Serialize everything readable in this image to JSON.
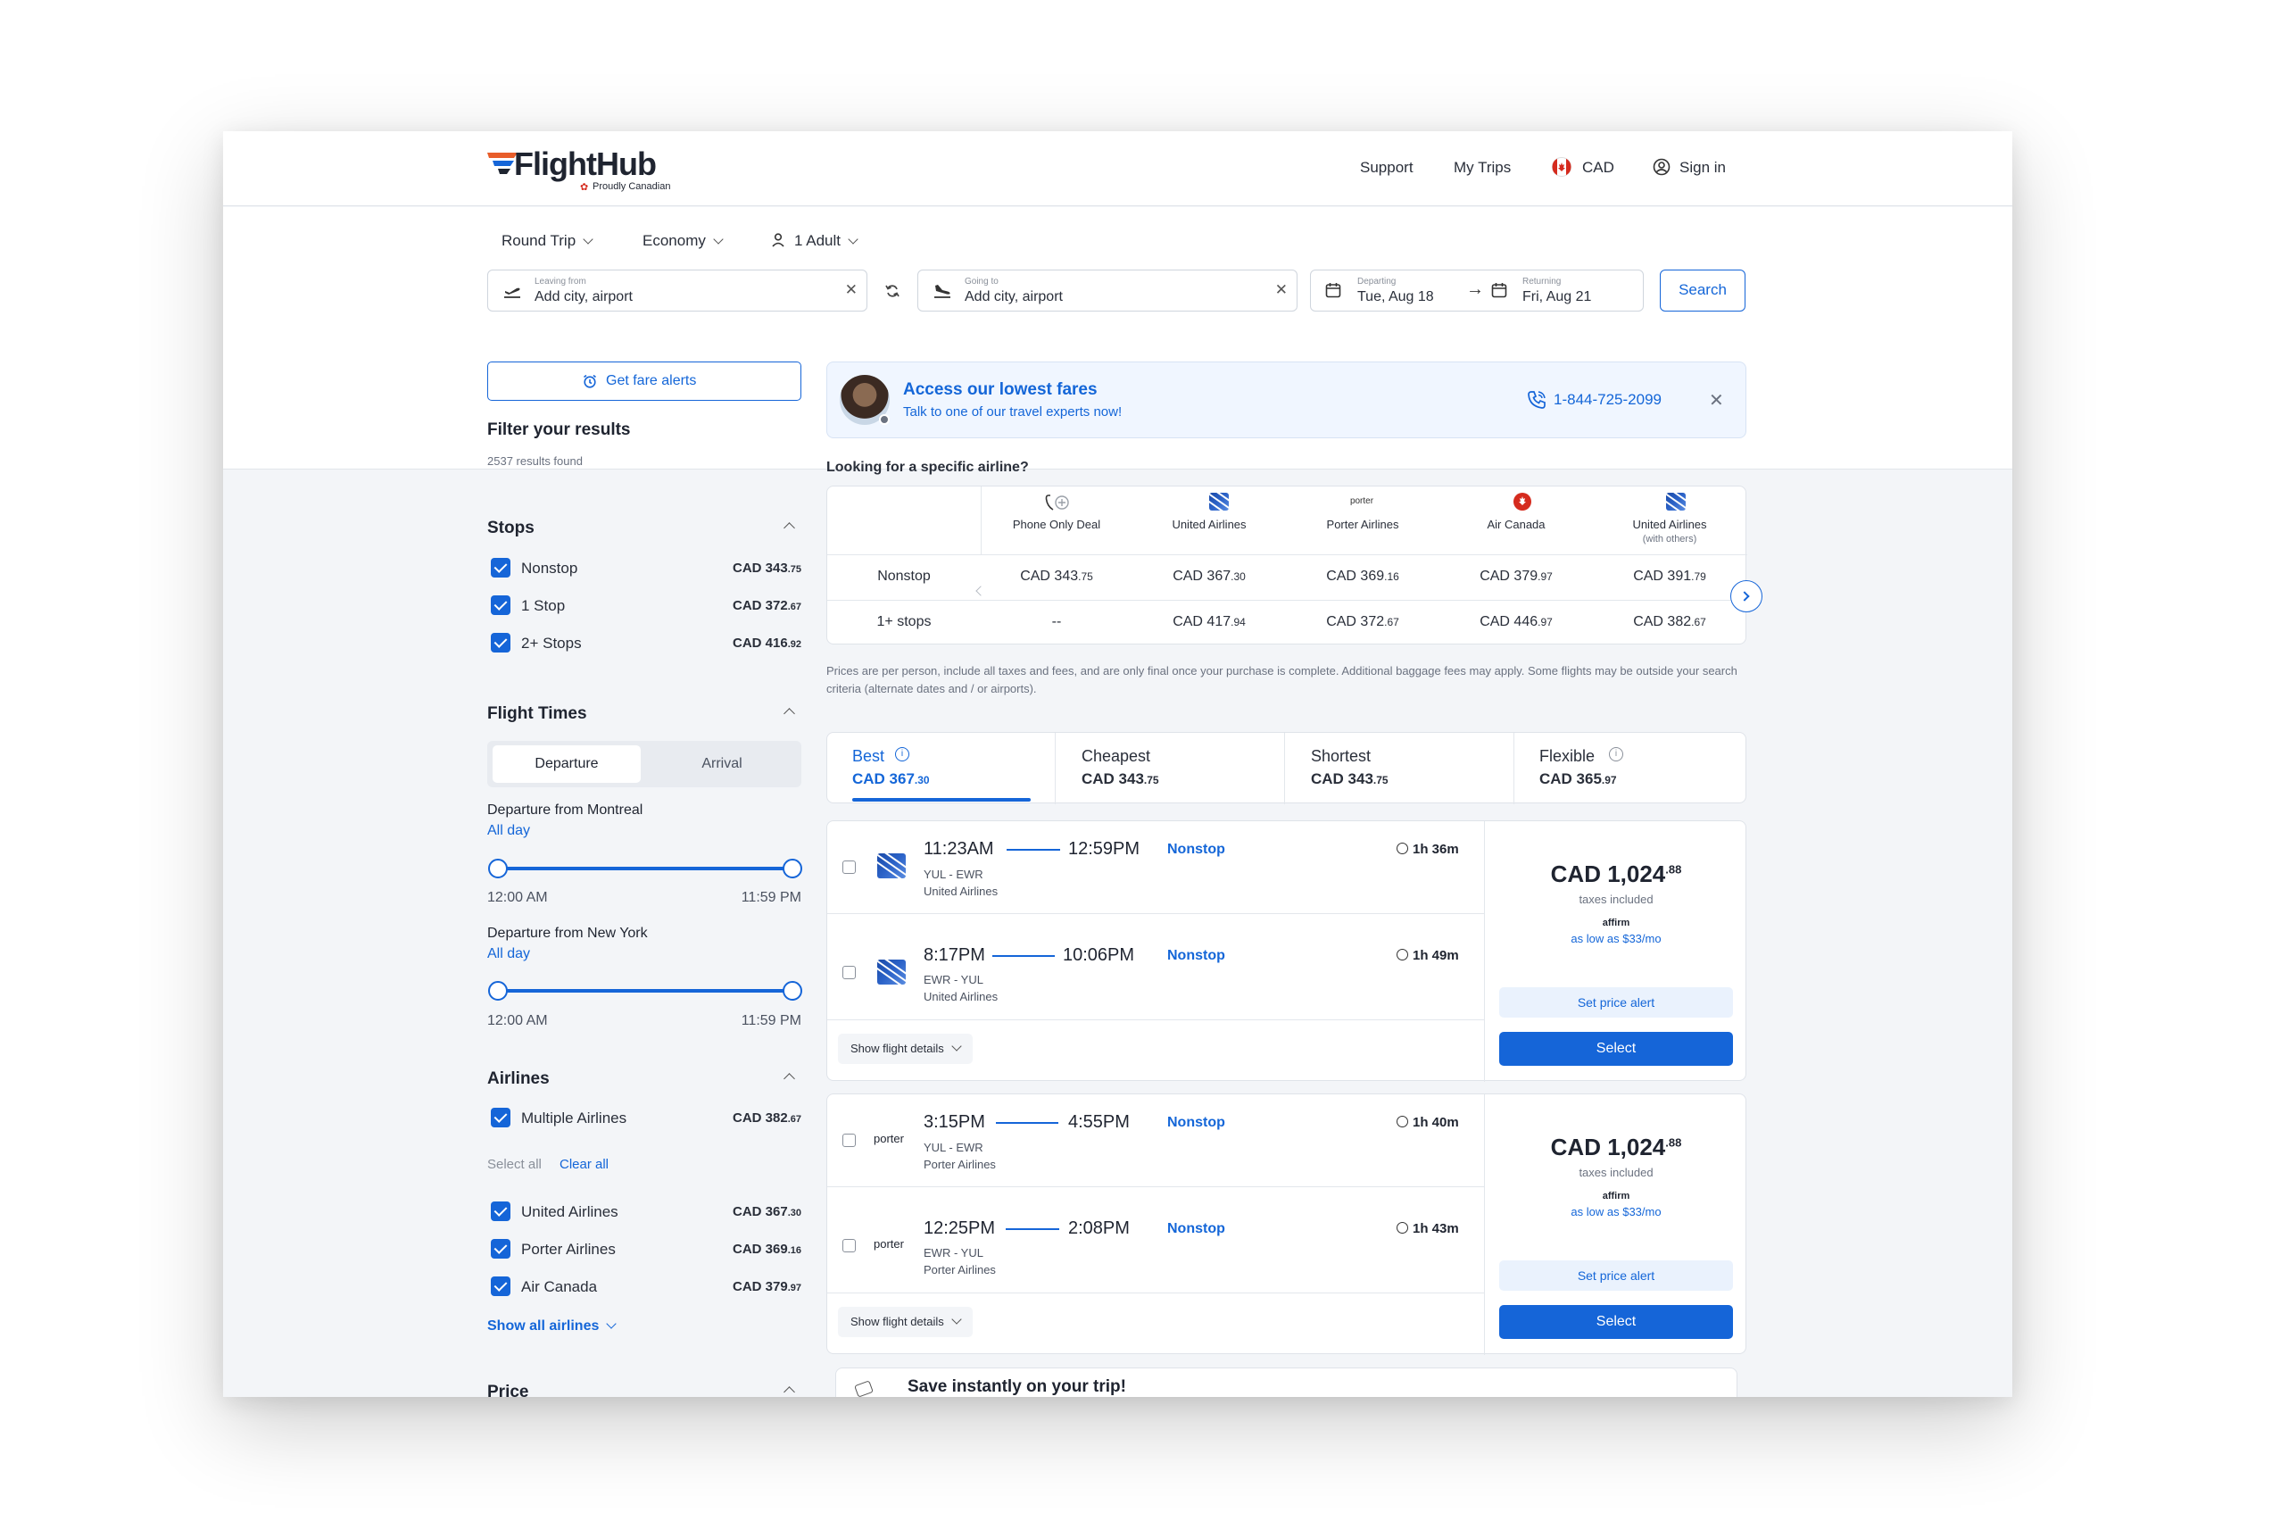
{
  "brand": {
    "name": "FlightHub",
    "tagline": "Proudly Canadian",
    "accent": "#1565d8",
    "orange": "#e85d2a"
  },
  "nav": {
    "support": "Support",
    "my_trips": "My Trips",
    "currency": "CAD",
    "sign_in": "Sign in"
  },
  "search": {
    "trip_type": "Round Trip",
    "cabin": "Economy",
    "passengers": "1 Adult",
    "from_label": "Leaving from",
    "from_placeholder": "Add city, airport",
    "to_label": "Going to",
    "to_placeholder": "Add city, airport",
    "depart_label": "Departing",
    "depart_value": "Tue, Aug 18",
    "return_label": "Returning",
    "return_value": "Fri, Aug 21",
    "search_button": "Search"
  },
  "sidebar": {
    "fare_alerts": "Get fare alerts",
    "filter_title": "Filter your results",
    "results_found": "2537 results found",
    "stops_title": "Stops",
    "stops": [
      {
        "label": "Nonstop",
        "price": "CAD 343",
        "cents": ".75"
      },
      {
        "label": "1 Stop",
        "price": "CAD 372",
        "cents": ".67"
      },
      {
        "label": "2+ Stops",
        "price": "CAD 416",
        "cents": ".92"
      }
    ],
    "times_title": "Flight Times",
    "times_tabs": [
      "Departure",
      "Arrival"
    ],
    "dep1_title": "Departure from Montreal",
    "dep1_value": "All day",
    "dep2_title": "Departure from New York",
    "dep2_value": "All day",
    "range_min": "12:00 AM",
    "range_max": "11:59 PM",
    "airlines_title": "Airlines",
    "multiple": {
      "label": "Multiple Airlines",
      "price": "CAD 382",
      "cents": ".67"
    },
    "select_all": "Select all",
    "clear_all": "Clear all",
    "airlines": [
      {
        "label": "United Airlines",
        "price": "CAD 367",
        "cents": ".30"
      },
      {
        "label": "Porter Airlines",
        "price": "CAD 369",
        "cents": ".16"
      },
      {
        "label": "Air Canada",
        "price": "CAD 379",
        "cents": ".97"
      }
    ],
    "show_all": "Show all airlines",
    "next_section": "Price"
  },
  "promo": {
    "title": "Access our lowest fares",
    "subtitle": "Talk to one of our travel experts now!",
    "phone": "1-844-725-2099"
  },
  "matrix": {
    "question": "Looking for a specific airline?",
    "airlines": [
      {
        "name": "Phone Only Deal",
        "sub": ""
      },
      {
        "name": "United Airlines",
        "sub": ""
      },
      {
        "name": "Porter Airlines",
        "sub": ""
      },
      {
        "name": "Air Canada",
        "sub": ""
      },
      {
        "name": "United Airlines",
        "sub": "(with others)"
      }
    ],
    "porter_logo": "porter",
    "rows": [
      {
        "label": "Nonstop",
        "cells": [
          [
            "CAD 343",
            ".75"
          ],
          [
            "CAD 367",
            ".30"
          ],
          [
            "CAD 369",
            ".16"
          ],
          [
            "CAD 379",
            ".97"
          ],
          [
            "CAD 391",
            ".79"
          ]
        ]
      },
      {
        "label": "1+ stops",
        "cells": [
          [
            "--",
            ""
          ],
          [
            "CAD 417",
            ".94"
          ],
          [
            "CAD 372",
            ".67"
          ],
          [
            "CAD 446",
            ".97"
          ],
          [
            "CAD 382",
            ".67"
          ]
        ]
      }
    ]
  },
  "disclaimer": "Prices are per person, include all taxes and fees, and are only final once your purchase is complete. Additional baggage fees may apply. Some flights may be outside your search criteria (alternate dates and / or airports).",
  "sort": [
    {
      "label": "Best",
      "price": "CAD 367",
      "cents": ".30"
    },
    {
      "label": "Cheapest",
      "price": "CAD 343",
      "cents": ".75"
    },
    {
      "label": "Shortest",
      "price": "CAD 343",
      "cents": ".75"
    },
    {
      "label": "Flexible",
      "price": "CAD 365",
      "cents": ".97"
    }
  ],
  "results": [
    {
      "legs": [
        {
          "dep": "11:23AM",
          "arr": "12:59PM",
          "stops": "Nonstop",
          "duration": "1h 36m",
          "route": "YUL - EWR",
          "airline": "United Airlines"
        },
        {
          "dep": "8:17PM",
          "arr": "10:06PM",
          "stops": "Nonstop",
          "duration": "1h 49m",
          "route": "EWR - YUL",
          "airline": "United Airlines"
        }
      ],
      "price": "CAD 1,024",
      "cents": ".88",
      "taxes": "taxes included",
      "affirm": "affirm",
      "monthly": "as low as $33/mo",
      "alert": "Set price alert",
      "select": "Select",
      "details": "Show flight details"
    },
    {
      "legs": [
        {
          "dep": "3:15PM",
          "arr": "4:55PM",
          "stops": "Nonstop",
          "duration": "1h 40m",
          "route": "YUL - EWR",
          "airline": "Porter Airlines"
        },
        {
          "dep": "12:25PM",
          "arr": "2:08PM",
          "stops": "Nonstop",
          "duration": "1h 43m",
          "route": "EWR - YUL",
          "airline": "Porter Airlines"
        }
      ],
      "price": "CAD 1,024",
      "cents": ".88",
      "taxes": "taxes included",
      "affirm": "affirm",
      "monthly": "as low as $33/mo",
      "alert": "Set price alert",
      "select": "Select",
      "details": "Show flight details"
    }
  ],
  "save_banner": "Save instantly on your trip!"
}
